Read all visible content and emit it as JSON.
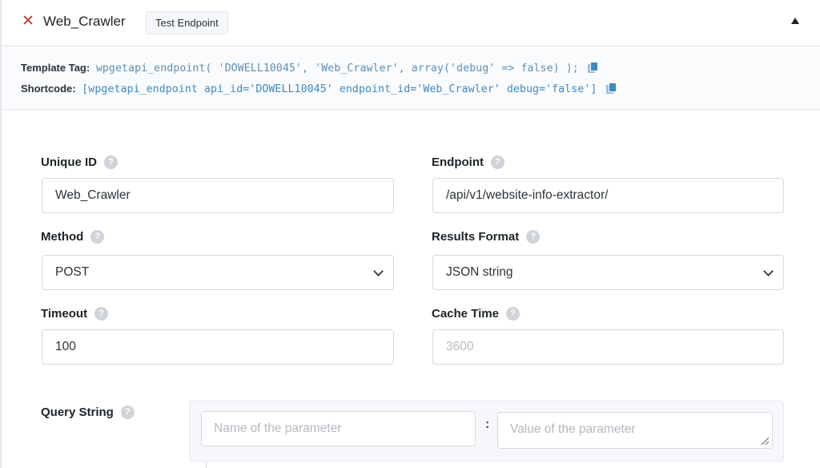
{
  "header": {
    "endpoint_name": "Web_Crawler",
    "test_button_label": "Test Endpoint",
    "close_icon": "x-icon",
    "collapse_icon": "triangle-up-icon"
  },
  "tags": {
    "template_tag_label": "Template Tag:",
    "template_tag_code": "wpgetapi_endpoint( 'DOWELL10045', 'Web_Crawler', array('debug' => false) );",
    "shortcode_label": "Shortcode:",
    "shortcode_code": "[wpgetapi_endpoint api_id='DOWELL10045' endpoint_id='Web_Crawler' debug='false']",
    "copy_icon": "copy-icon"
  },
  "form": {
    "unique_id": {
      "label": "Unique ID",
      "value": "Web_Crawler"
    },
    "endpoint": {
      "label": "Endpoint",
      "value": "/api/v1/website-info-extractor/"
    },
    "method": {
      "label": "Method",
      "value": "POST"
    },
    "results_format": {
      "label": "Results Format",
      "value": "JSON string"
    },
    "timeout": {
      "label": "Timeout",
      "value": "100"
    },
    "cache_time": {
      "label": "Cache Time",
      "placeholder": "3600"
    },
    "query_string": {
      "label": "Query String",
      "name_placeholder": "Name of the parameter",
      "separator": ":",
      "value_placeholder": "Value of the parameter"
    },
    "help_glyph": "?"
  },
  "colors": {
    "close_red": "#c0392b",
    "code_blue": "#3e88c2"
  }
}
